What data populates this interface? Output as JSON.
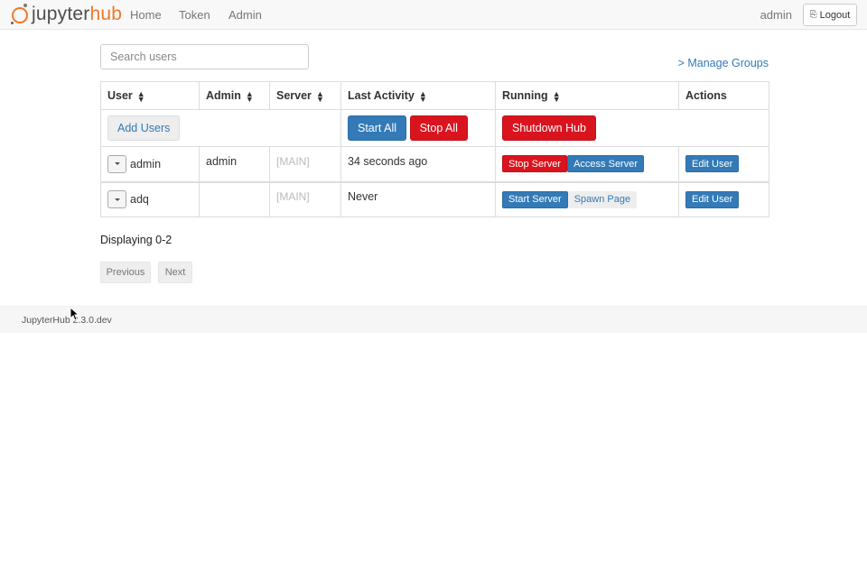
{
  "navbar": {
    "brand_prefix": "jupyter",
    "brand_suffix": "hub",
    "links": [
      "Home",
      "Token",
      "Admin"
    ],
    "user": "admin",
    "logout_label": "Logout",
    "logout_icon": "sign-out-icon"
  },
  "search": {
    "placeholder": "Search users",
    "value": ""
  },
  "manage_groups": "> Manage Groups",
  "table": {
    "headers": [
      "User",
      "Admin",
      "Server",
      "Last Activity",
      "Running",
      "Actions"
    ],
    "actions_row": {
      "add_users": "Add Users",
      "start_all": "Start All",
      "stop_all": "Stop All",
      "shutdown_hub": "Shutdown Hub"
    },
    "rows": [
      {
        "user": "admin",
        "admin": "admin",
        "server": "[MAIN]",
        "last_activity": "34 seconds ago",
        "running_primary": "Stop Server",
        "running_secondary": "Access Server",
        "action": "Edit User"
      },
      {
        "user": "adq",
        "admin": "",
        "server": "[MAIN]",
        "last_activity": "Never",
        "running_primary": "Start Server",
        "running_secondary": "Spawn Page",
        "action": "Edit User"
      }
    ]
  },
  "displaying": "Displaying 0-2",
  "pagination": {
    "previous": "Previous",
    "next": "Next"
  },
  "footer": "JupyterHub 2.3.0.dev",
  "colors": {
    "brand_orange": "#f37726",
    "primary": "#337ab7",
    "danger": "#d9141e",
    "link": "#337ab7"
  }
}
